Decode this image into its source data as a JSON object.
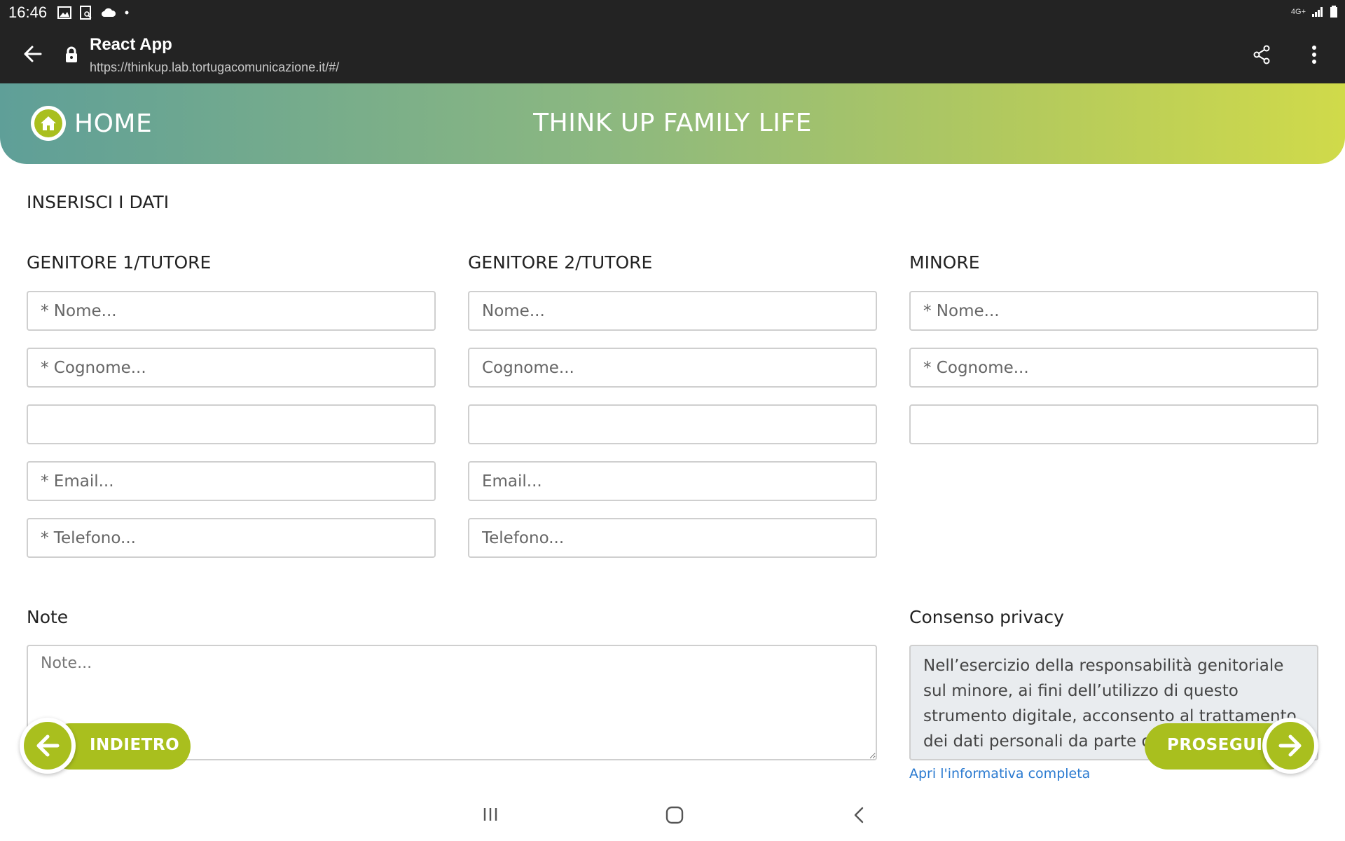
{
  "status_bar": {
    "time": "16:46",
    "network": "4G+",
    "icons": [
      "image-icon",
      "screenshot-icon",
      "cloud-icon",
      "dot-icon",
      "signal-icon",
      "battery-icon"
    ]
  },
  "browser": {
    "title": "React App",
    "url": "https://thinkup.lab.tortugacomunicazione.it/#/"
  },
  "header": {
    "home_label": "HOME",
    "app_title": "THINK UP FAMILY LIFE",
    "gradient": [
      "#5f9f98",
      "#8cb880",
      "#b2c95e",
      "#d0da4a"
    ]
  },
  "form": {
    "section_title": "INSERISCI I DATI",
    "columns": [
      {
        "title": "GENITORE 1/TUTORE",
        "fields": {
          "nome": "* Nome...",
          "cognome": "* Cognome...",
          "date": "",
          "email": "* Email...",
          "telefono": "* Telefono..."
        }
      },
      {
        "title": "GENITORE 2/TUTORE",
        "fields": {
          "nome": "Nome...",
          "cognome": "Cognome...",
          "date": "",
          "email": "Email...",
          "telefono": "Telefono..."
        }
      },
      {
        "title": "MINORE",
        "fields": {
          "nome": "* Nome...",
          "cognome": "* Cognome...",
          "date": ""
        }
      }
    ],
    "note": {
      "title": "Note",
      "placeholder": "Note..."
    },
    "privacy": {
      "title": "Consenso privacy",
      "text": "Nell’esercizio della responsabilità genitoriale sul minore, ai fini dell’utilizzo di questo strumento digitale, acconsento al trattamento dei dati personali da parte di Associazione che gestisce il progetto e quindi al fine",
      "link": "Apri l'informativa completa"
    }
  },
  "nav_buttons": {
    "back_label": "INDIETRO",
    "next_label": "PROSEGUI",
    "accent": "#a9bf1e"
  }
}
